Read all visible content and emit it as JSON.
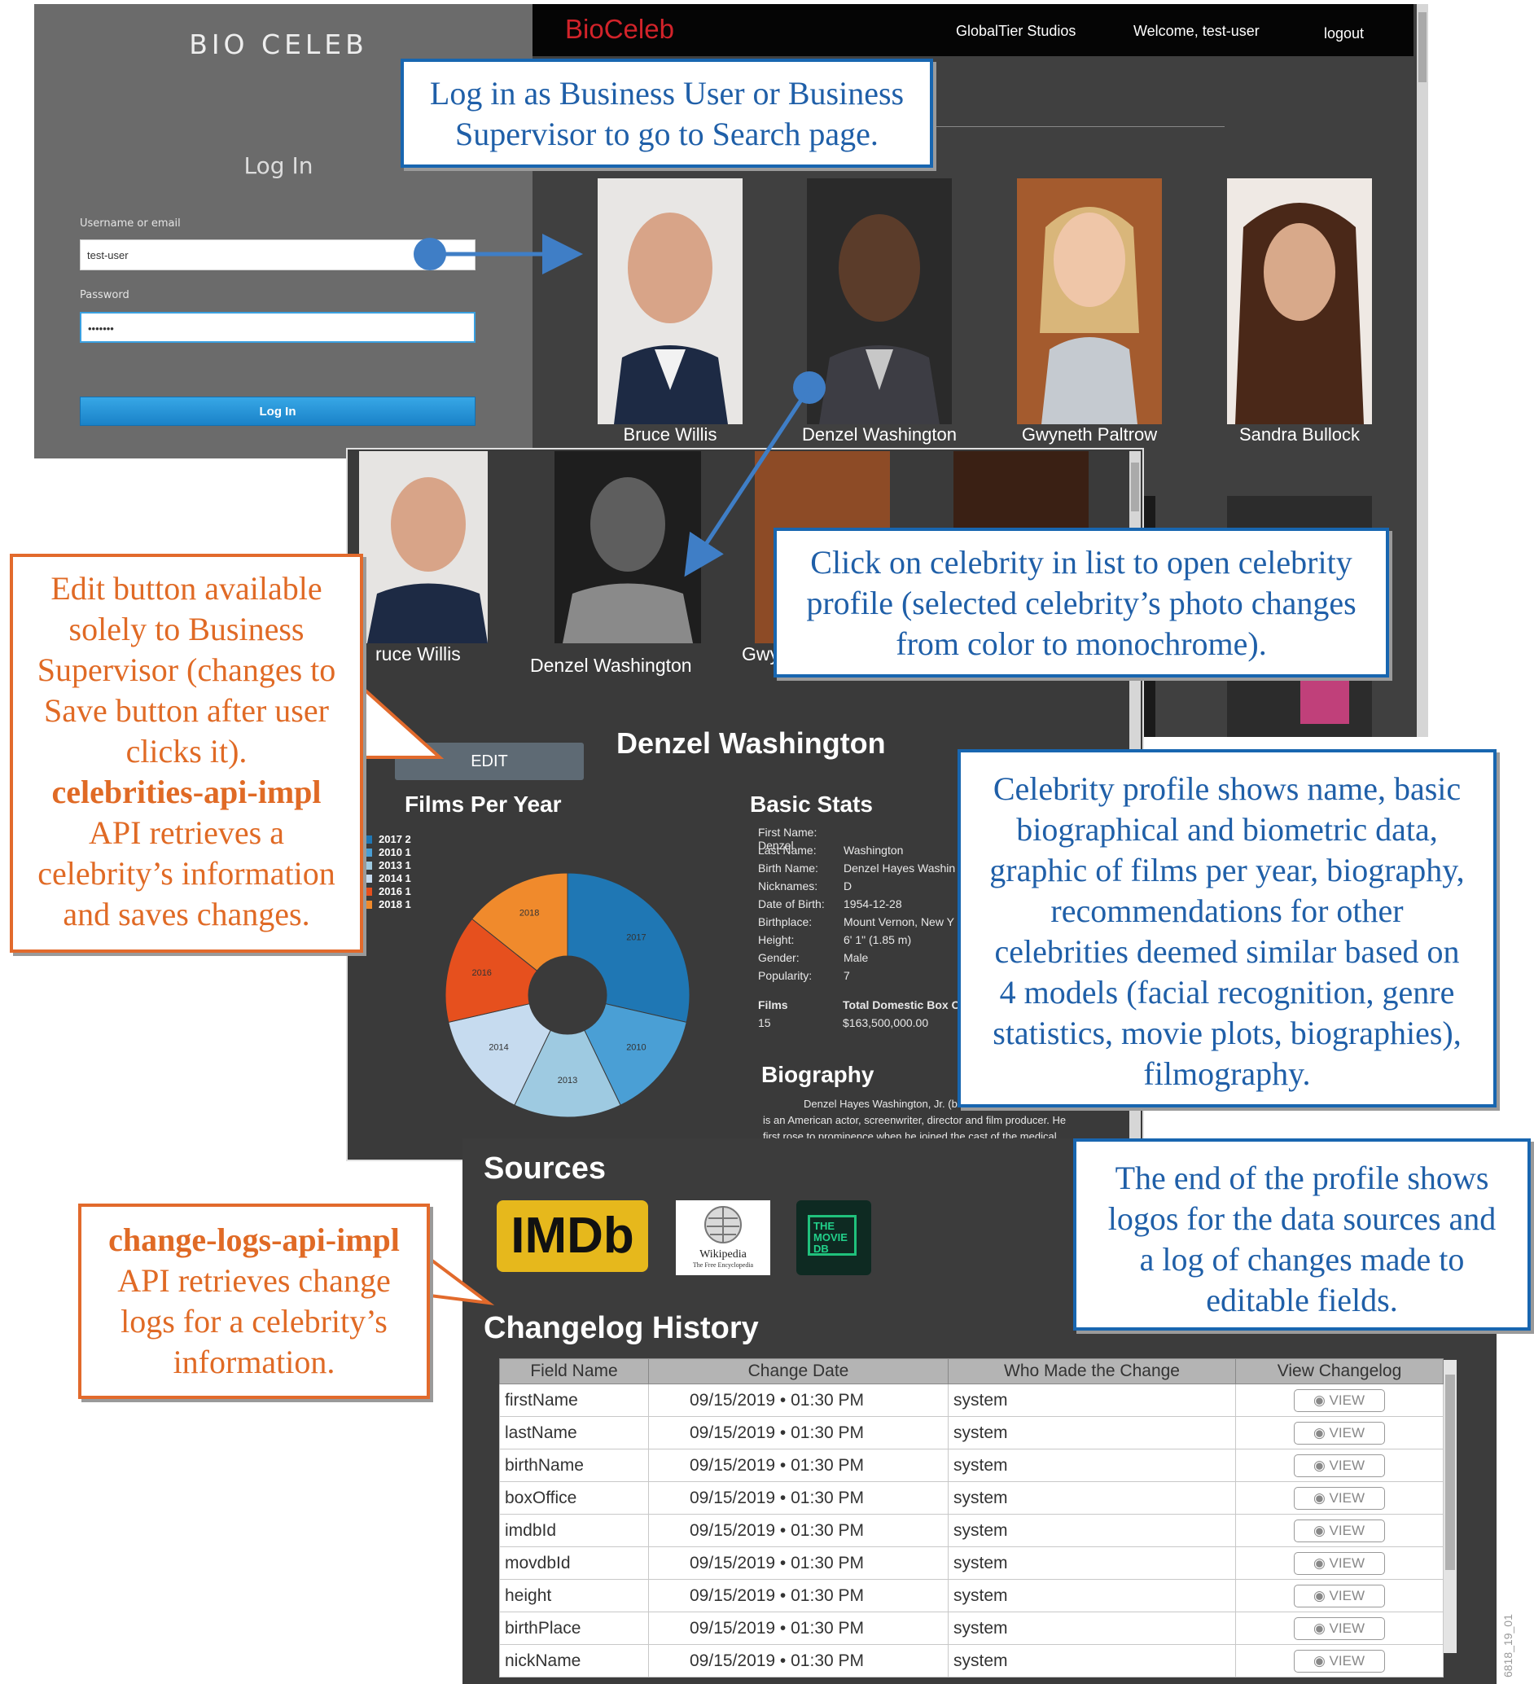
{
  "login": {
    "brand": "BIO CELEB",
    "title": "Log In",
    "username_label": "Username or email",
    "username_value": "test-user",
    "password_label": "Password",
    "password_value": "•••••••",
    "button": "Log In"
  },
  "header": {
    "logo": "BioCeleb",
    "studio": "GlobalTier Studios",
    "welcome": "Welcome, test-user",
    "logout": "logout"
  },
  "celebrities": [
    {
      "name": "Bruce Willis",
      "color": "#c9b6a6"
    },
    {
      "name": "Denzel Washington",
      "color": "#5b4636"
    },
    {
      "name": "Gwyneth Paltrow",
      "color": "#c99664"
    },
    {
      "name": "Sandra Bullock",
      "color": "#7a4a34"
    }
  ],
  "profile": {
    "list_labels": [
      "ruce Willis",
      "Denzel Washington",
      "Gwy"
    ],
    "edit": "EDIT",
    "name": "Denzel Washington",
    "films_title": "Films Per Year",
    "stats_title": "Basic Stats",
    "stats": [
      {
        "k": "First Name:",
        "v": "Denzel"
      },
      {
        "k": "Last Name:",
        "v": "Washington"
      },
      {
        "k": "Birth Name:",
        "v": "Denzel Hayes Washin"
      },
      {
        "k": "Nicknames:",
        "v": "D"
      },
      {
        "k": "Date of Birth:",
        "v": "1954-12-28"
      },
      {
        "k": "Birthplace:",
        "v": "Mount Vernon, New Y"
      },
      {
        "k": "Height:",
        "v": "6' 1\" (1.85 m)"
      },
      {
        "k": "Gender:",
        "v": "Male"
      },
      {
        "k": "Popularity:",
        "v": "7"
      }
    ],
    "films_label": "Films",
    "films_value": "15",
    "box_label": "Total Domestic Box O",
    "box_value": "$163,500,000.00",
    "bio_title": "Biography",
    "bio_lines": [
      "Denzel Hayes Washington, Jr. (b",
      "is an American actor, screenwriter, director and film producer. He",
      "first rose to prominence when he joined the cast of the medical"
    ]
  },
  "chart_data": {
    "type": "pie",
    "categories": [
      "2017",
      "2010",
      "2013",
      "2014",
      "2016",
      "2018"
    ],
    "values": [
      2,
      1,
      1,
      1,
      1,
      1
    ],
    "colors": [
      "#1f77b4",
      "#4a9fd5",
      "#9ecae1",
      "#c6dbef",
      "#e6501e",
      "#f08a2c"
    ],
    "legend": "top-left",
    "donut": true
  },
  "sources": {
    "title": "Sources",
    "imdb": "IMDb",
    "wiki": "Wikipedia",
    "wiki_sub": "The Free Encyclopedia",
    "tmdb": "THE MOVIE DB"
  },
  "changelog": {
    "title": "Changelog History",
    "columns": [
      "Field Name",
      "Change Date",
      "Who Made the Change",
      "View Changelog"
    ],
    "view_label": "VIEW",
    "rows": [
      {
        "field": "firstName",
        "date": "09/15/2019 • 01:30 PM",
        "who": "system"
      },
      {
        "field": "lastName",
        "date": "09/15/2019 • 01:30 PM",
        "who": "system"
      },
      {
        "field": "birthName",
        "date": "09/15/2019 • 01:30 PM",
        "who": "system"
      },
      {
        "field": "boxOffice",
        "date": "09/15/2019 • 01:30 PM",
        "who": "system"
      },
      {
        "field": "imdbId",
        "date": "09/15/2019 • 01:30 PM",
        "who": "system"
      },
      {
        "field": "movdbId",
        "date": "09/15/2019 • 01:30 PM",
        "who": "system"
      },
      {
        "field": "height",
        "date": "09/15/2019 • 01:30 PM",
        "who": "system"
      },
      {
        "field": "birthPlace",
        "date": "09/15/2019 • 01:30 PM",
        "who": "system"
      },
      {
        "field": "nickName",
        "date": "09/15/2019 • 01:30 PM",
        "who": "system"
      }
    ]
  },
  "callouts": {
    "login_note": [
      "Log in as Business User or Business",
      "Supervisor to go to Search page."
    ],
    "click_note": [
      "Click on celebrity in list to open celebrity",
      "profile (selected celebrity’s photo changes",
      "from color to monochrome)."
    ],
    "edit_note": [
      "Edit button available",
      "solely to Business",
      "Supervisor (changes to",
      "Save button after user",
      "clicks it)."
    ],
    "edit_api": "celebrities-api-impl",
    "edit_api_text": [
      "API retrieves a",
      "celebrity’s information",
      "and saves changes."
    ],
    "profile_note": [
      "Celebrity profile shows name, basic",
      "biographical and biometric data,",
      "graphic of films per year, biography,",
      "recommendations for other",
      "celebrities deemed similar based on",
      "4 models (facial recognition, genre",
      "statistics, movie plots, biographies),",
      "filmography."
    ],
    "end_note": [
      "The end of the profile shows",
      "logos for the data sources and",
      "a log of changes made to",
      "editable fields."
    ],
    "changelog_api": "change-logs-api-impl",
    "changelog_api_text": [
      "API retrieves change",
      "logs for a celebrity’s",
      "information."
    ]
  },
  "figure_id": "6818_19_01"
}
